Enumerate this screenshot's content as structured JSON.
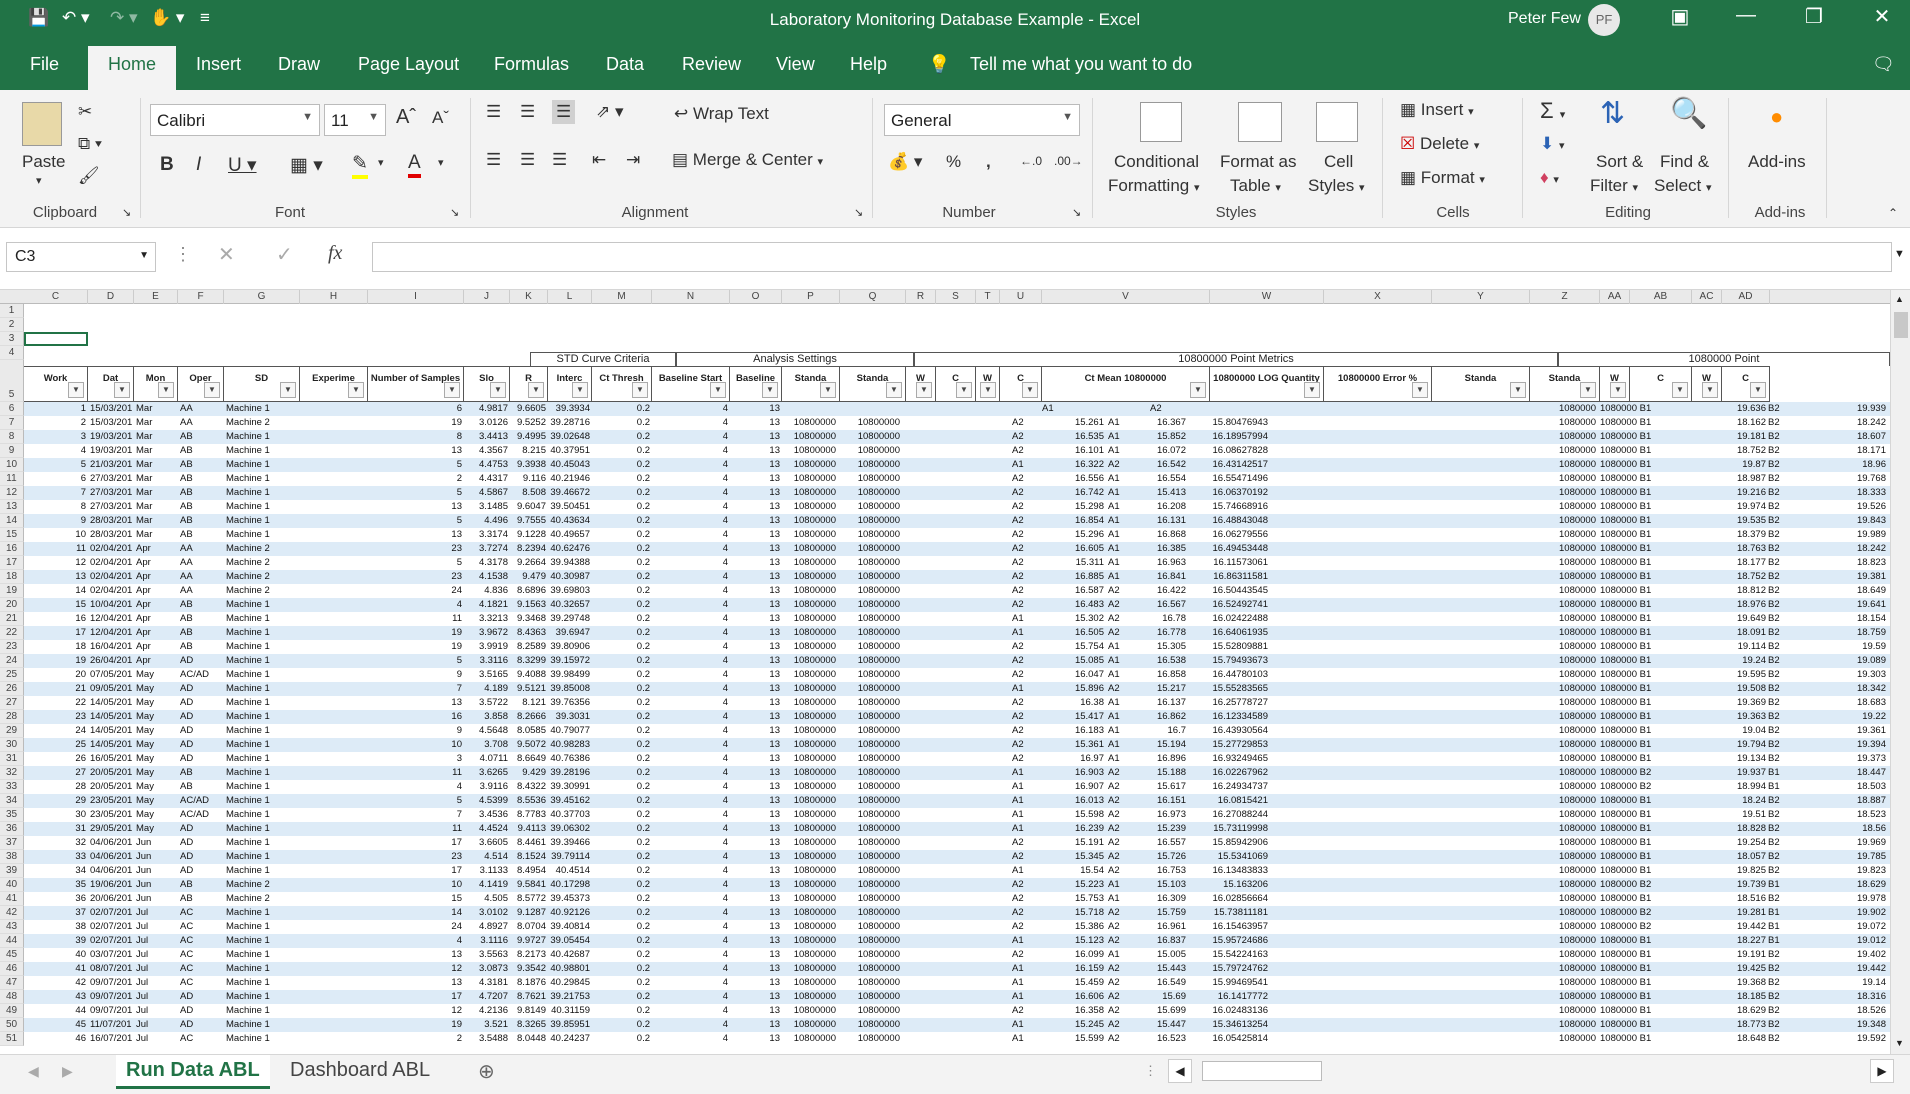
{
  "window": {
    "title": "Laboratory Monitoring Database Example  -  Excel",
    "user": "Peter Few",
    "initials": "PF"
  },
  "tabs": [
    "File",
    "Home",
    "Insert",
    "Draw",
    "Page Layout",
    "Formulas",
    "Data",
    "Review",
    "View",
    "Help"
  ],
  "tell_me": "Tell me what you want to do",
  "ribbon": {
    "clipboard": {
      "paste": "Paste",
      "label": "Clipboard"
    },
    "font": {
      "name": "Calibri",
      "size": "11",
      "label": "Font"
    },
    "alignment": {
      "wrap": "Wrap Text",
      "merge": "Merge & Center",
      "label": "Alignment"
    },
    "number": {
      "format": "General",
      "label": "Number",
      "pct": "%",
      "comma": ","
    },
    "styles": {
      "cond1": "Conditional",
      "cond2": "Formatting",
      "fmt1": "Format as",
      "fmt2": "Table",
      "cell1": "Cell",
      "cell2": "Styles",
      "label": "Styles"
    },
    "cells": {
      "insert": "Insert",
      "delete": "Delete",
      "format": "Format",
      "label": "Cells"
    },
    "editing": {
      "sort1": "Sort &",
      "sort2": "Filter",
      "find1": "Find &",
      "find2": "Select",
      "label": "Editing"
    },
    "addins": {
      "name": "Add-ins",
      "label": "Add-ins"
    }
  },
  "formula": {
    "namebox": "C3",
    "content": ""
  },
  "columns": [
    "C",
    "D",
    "E",
    "F",
    "G",
    "H",
    "I",
    "J",
    "K",
    "L",
    "M",
    "N",
    "O",
    "P",
    "Q",
    "R",
    "S",
    "T",
    "U",
    "V",
    "W",
    "X",
    "Y",
    "Z",
    "AA",
    "AB",
    "AC",
    "AD"
  ],
  "bands": {
    "std": "STD Curve Criteria",
    "analysis": "Analysis Settings",
    "metrics": "10800000 Point Metrics",
    "metrics2": "1080000 Point"
  },
  "headers": [
    "Work",
    "Dat",
    "Mon",
    "Oper",
    "SD",
    "Experime",
    "Number of Samples",
    "Slo",
    "R",
    "Interc",
    "Ct Thresh",
    "Baseline Start",
    "Baseline",
    "Standa",
    "Standa",
    "W",
    "C",
    "W",
    "C",
    "Ct Mean 10800000",
    "10800000 LOG Quantity",
    "10800000 Error %",
    "Standa",
    "Standa",
    "W",
    "C",
    "W",
    "C"
  ],
  "row6": {
    "num": "1",
    "date": "15/03/2019",
    "mon": "Mar",
    "op": "AA",
    "sd": "Machine 1",
    "ns": "6",
    "slope": "4.9817",
    "r": "9.6605",
    "int": "39.3934",
    "ct": "0.2",
    "bs": "4",
    "be": "13",
    "w1": "A1",
    "w2": "A2",
    "s3": "1080000",
    "s4": "1080000 B1",
    "cb": "19.636",
    "wb": "B2",
    "cd": "19.939"
  },
  "rows": [
    [
      "2",
      "15/03/2019",
      "Mar",
      "AA",
      "Machine 2",
      "19",
      "3.0126",
      "9.5252",
      "39.28716",
      "A2",
      "15.261",
      "A1",
      "16.367",
      "15.80476943",
      "1080000 B1",
      "18.162",
      "B2",
      "18.242"
    ],
    [
      "3",
      "19/03/2019",
      "Mar",
      "AB",
      "Machine 1",
      "8",
      "3.4413",
      "9.4995",
      "39.02648",
      "A2",
      "16.535",
      "A1",
      "15.852",
      "16.18957994",
      "1080000 B1",
      "19.181",
      "B2",
      "18.607"
    ],
    [
      "4",
      "19/03/2019",
      "Mar",
      "AB",
      "Machine 1",
      "13",
      "4.3567",
      "8.215",
      "40.37951",
      "A2",
      "16.101",
      "A1",
      "16.072",
      "16.08627828",
      "1080000 B1",
      "18.752",
      "B2",
      "18.171"
    ],
    [
      "5",
      "21/03/2019",
      "Mar",
      "AB",
      "Machine 1",
      "5",
      "4.4753",
      "9.3938",
      "40.45043",
      "A1",
      "16.322",
      "A2",
      "16.542",
      "16.43142517",
      "1080000 B1",
      "19.87",
      "B2",
      "18.96"
    ],
    [
      "6",
      "27/03/2019",
      "Mar",
      "AB",
      "Machine 1",
      "2",
      "4.4317",
      "9.116",
      "40.21946",
      "A2",
      "16.556",
      "A1",
      "16.554",
      "16.55471496",
      "1080000 B1",
      "18.987",
      "B2",
      "19.768"
    ],
    [
      "7",
      "27/03/2019",
      "Mar",
      "AB",
      "Machine 1",
      "5",
      "4.5867",
      "8.508",
      "39.46672",
      "A2",
      "16.742",
      "A1",
      "15.413",
      "16.06370192",
      "1080000 B1",
      "19.216",
      "B2",
      "18.333"
    ],
    [
      "8",
      "27/03/2019",
      "Mar",
      "AB",
      "Machine 1",
      "13",
      "3.1485",
      "9.6047",
      "39.50451",
      "A2",
      "15.298",
      "A1",
      "16.208",
      "15.74668916",
      "1080000 B1",
      "19.974",
      "B2",
      "19.526"
    ],
    [
      "9",
      "28/03/2019",
      "Mar",
      "AB",
      "Machine 1",
      "5",
      "4.496",
      "9.7555",
      "40.43634",
      "A2",
      "16.854",
      "A1",
      "16.131",
      "16.48843048",
      "1080000 B1",
      "19.535",
      "B2",
      "19.843"
    ],
    [
      "10",
      "28/03/2019",
      "Mar",
      "AB",
      "Machine 1",
      "13",
      "3.3174",
      "9.1228",
      "40.49657",
      "A2",
      "15.296",
      "A1",
      "16.868",
      "16.06279556",
      "1080000 B1",
      "18.379",
      "B2",
      "19.989"
    ],
    [
      "11",
      "02/04/2019",
      "Apr",
      "AA",
      "Machine 2",
      "23",
      "3.7274",
      "8.2394",
      "40.62476",
      "A2",
      "16.605",
      "A1",
      "16.385",
      "16.49453448",
      "1080000 B1",
      "18.763",
      "B2",
      "18.242"
    ],
    [
      "12",
      "02/04/2019",
      "Apr",
      "AA",
      "Machine 2",
      "5",
      "4.3178",
      "9.2664",
      "39.94388",
      "A2",
      "15.311",
      "A1",
      "16.963",
      "16.11573061",
      "1080000 B1",
      "18.177",
      "B2",
      "18.823"
    ],
    [
      "13",
      "02/04/2019",
      "Apr",
      "AA",
      "Machine 2",
      "23",
      "4.1538",
      "9.479",
      "40.30987",
      "A2",
      "16.885",
      "A1",
      "16.841",
      "16.86311581",
      "1080000 B1",
      "18.752",
      "B2",
      "19.381"
    ],
    [
      "14",
      "02/04/2019",
      "Apr",
      "AA",
      "Machine 2",
      "24",
      "4.836",
      "8.6896",
      "39.69803",
      "A2",
      "16.587",
      "A2",
      "16.422",
      "16.50443545",
      "1080000 B1",
      "18.812",
      "B2",
      "18.649"
    ],
    [
      "15",
      "10/04/2019",
      "Apr",
      "AB",
      "Machine 1",
      "4",
      "4.1821",
      "9.1563",
      "40.32657",
      "A2",
      "16.483",
      "A2",
      "16.567",
      "16.52492741",
      "1080000 B1",
      "18.976",
      "B2",
      "19.641"
    ],
    [
      "16",
      "12/04/2019",
      "Apr",
      "AB",
      "Machine 1",
      "11",
      "3.3213",
      "9.3468",
      "39.29748",
      "A1",
      "15.302",
      "A2",
      "16.78",
      "16.02422488",
      "1080000 B1",
      "19.649",
      "B2",
      "18.154"
    ],
    [
      "17",
      "12/04/2019",
      "Apr",
      "AB",
      "Machine 1",
      "19",
      "3.9672",
      "8.4363",
      "39.6947",
      "A1",
      "16.505",
      "A2",
      "16.778",
      "16.64061935",
      "1080000 B1",
      "18.091",
      "B2",
      "18.759"
    ],
    [
      "18",
      "16/04/2019",
      "Apr",
      "AB",
      "Machine 1",
      "19",
      "3.9919",
      "8.2589",
      "39.80906",
      "A2",
      "15.754",
      "A1",
      "15.305",
      "15.52809881",
      "1080000 B1",
      "19.114",
      "B2",
      "19.59"
    ],
    [
      "19",
      "26/04/2019",
      "Apr",
      "AD",
      "Machine 1",
      "5",
      "3.3116",
      "8.3299",
      "39.15972",
      "A2",
      "15.085",
      "A1",
      "16.538",
      "15.79493673",
      "1080000 B1",
      "19.24",
      "B2",
      "19.089"
    ],
    [
      "20",
      "07/05/2019",
      "May",
      "AC/AD",
      "Machine 1",
      "9",
      "3.5165",
      "9.4088",
      "39.98499",
      "A2",
      "16.047",
      "A1",
      "16.858",
      "16.44780103",
      "1080000 B1",
      "19.595",
      "B2",
      "19.303"
    ],
    [
      "21",
      "09/05/2019",
      "May",
      "AD",
      "Machine 1",
      "7",
      "4.189",
      "9.5121",
      "39.85008",
      "A1",
      "15.896",
      "A2",
      "15.217",
      "15.55283565",
      "1080000 B1",
      "19.508",
      "B2",
      "18.342"
    ],
    [
      "22",
      "14/05/2019",
      "May",
      "AD",
      "Machine 1",
      "13",
      "3.5722",
      "8.121",
      "39.76356",
      "A2",
      "16.38",
      "A1",
      "16.137",
      "16.25778727",
      "1080000 B1",
      "19.369",
      "B2",
      "18.683"
    ],
    [
      "23",
      "14/05/2019",
      "May",
      "AD",
      "Machine 1",
      "16",
      "3.858",
      "8.2666",
      "39.3031",
      "A2",
      "15.417",
      "A1",
      "16.862",
      "16.12334589",
      "1080000 B1",
      "19.363",
      "B2",
      "19.22"
    ],
    [
      "24",
      "14/05/2019",
      "May",
      "AD",
      "Machine 1",
      "9",
      "4.5648",
      "8.0585",
      "40.79077",
      "A2",
      "16.183",
      "A1",
      "16.7",
      "16.43930564",
      "1080000 B1",
      "19.04",
      "B2",
      "19.361"
    ],
    [
      "25",
      "14/05/2019",
      "May",
      "AD",
      "Machine 1",
      "10",
      "3.708",
      "9.5072",
      "40.98283",
      "A2",
      "15.361",
      "A1",
      "15.194",
      "15.27729853",
      "1080000 B1",
      "19.794",
      "B2",
      "19.394"
    ],
    [
      "26",
      "16/05/2019",
      "May",
      "AD",
      "Machine 1",
      "3",
      "4.0711",
      "8.6649",
      "40.76386",
      "A2",
      "16.97",
      "A1",
      "16.896",
      "16.93249465",
      "1080000 B1",
      "19.134",
      "B2",
      "19.373"
    ],
    [
      "27",
      "20/05/2019",
      "May",
      "AB",
      "Machine 1",
      "11",
      "3.6265",
      "9.429",
      "39.28196",
      "A1",
      "16.903",
      "A2",
      "15.188",
      "16.02267962",
      "1080000 B2",
      "19.937",
      "B1",
      "18.447"
    ],
    [
      "28",
      "20/05/2019",
      "May",
      "AB",
      "Machine 1",
      "4",
      "3.9116",
      "8.4322",
      "39.30991",
      "A1",
      "16.907",
      "A2",
      "15.617",
      "16.24934737",
      "1080000 B2",
      "18.994",
      "B1",
      "18.503"
    ],
    [
      "29",
      "23/05/2019",
      "May",
      "AC/AD",
      "Machine 1",
      "5",
      "4.5399",
      "8.5536",
      "39.45162",
      "A1",
      "16.013",
      "A2",
      "16.151",
      "16.0815421",
      "1080000 B1",
      "18.24",
      "B2",
      "18.887"
    ],
    [
      "30",
      "23/05/2019",
      "May",
      "AC/AD",
      "Machine 1",
      "7",
      "3.4536",
      "8.7783",
      "40.37703",
      "A1",
      "15.598",
      "A2",
      "16.973",
      "16.27088244",
      "1080000 B1",
      "19.51",
      "B2",
      "18.523"
    ],
    [
      "31",
      "29/05/2019",
      "May",
      "AD",
      "Machine 1",
      "11",
      "4.4524",
      "9.4113",
      "39.06302",
      "A1",
      "16.239",
      "A2",
      "15.239",
      "15.73119998",
      "1080000 B1",
      "18.828",
      "B2",
      "18.56"
    ],
    [
      "32",
      "04/06/2019",
      "Jun",
      "AD",
      "Machine 1",
      "17",
      "3.6605",
      "8.4461",
      "39.39466",
      "A2",
      "15.191",
      "A2",
      "16.557",
      "15.85942906",
      "1080000 B1",
      "19.254",
      "B2",
      "19.969"
    ],
    [
      "33",
      "04/06/2019",
      "Jun",
      "AD",
      "Machine 1",
      "23",
      "4.514",
      "8.1524",
      "39.79114",
      "A2",
      "15.345",
      "A2",
      "15.726",
      "15.5341069",
      "1080000 B1",
      "18.057",
      "B2",
      "19.785"
    ],
    [
      "34",
      "04/06/2019",
      "Jun",
      "AD",
      "Machine 1",
      "17",
      "3.1133",
      "8.4954",
      "40.4514",
      "A1",
      "15.54",
      "A2",
      "16.753",
      "16.13483833",
      "1080000 B1",
      "19.825",
      "B2",
      "19.823"
    ],
    [
      "35",
      "19/06/2019",
      "Jun",
      "AB",
      "Machine 2",
      "10",
      "4.1419",
      "9.5841",
      "40.17298",
      "A2",
      "15.223",
      "A1",
      "15.103",
      "15.163206",
      "1080000 B2",
      "19.739",
      "B1",
      "18.629"
    ],
    [
      "36",
      "20/06/2019",
      "Jun",
      "AB",
      "Machine 2",
      "15",
      "4.505",
      "8.5772",
      "39.45373",
      "A2",
      "15.753",
      "A1",
      "16.309",
      "16.02856664",
      "1080000 B1",
      "18.516",
      "B2",
      "19.978"
    ],
    [
      "37",
      "02/07/2019",
      "Jul",
      "AC",
      "Machine 1",
      "14",
      "3.0102",
      "9.1287",
      "40.92126",
      "A2",
      "15.718",
      "A2",
      "15.759",
      "15.73811181",
      "1080000 B2",
      "19.281",
      "B1",
      "19.902"
    ],
    [
      "38",
      "02/07/2019",
      "Jul",
      "AC",
      "Machine 1",
      "24",
      "4.8927",
      "8.0704",
      "39.40814",
      "A2",
      "15.386",
      "A2",
      "16.961",
      "16.15463957",
      "1080000 B2",
      "19.442",
      "B1",
      "19.072"
    ],
    [
      "39",
      "02/07/2019",
      "Jul",
      "AC",
      "Machine 1",
      "4",
      "3.1116",
      "9.9727",
      "39.05454",
      "A1",
      "15.123",
      "A2",
      "16.837",
      "15.95724686",
      "1080000 B1",
      "18.227",
      "B1",
      "19.012"
    ],
    [
      "40",
      "03/07/2019",
      "Jul",
      "AC",
      "Machine 1",
      "13",
      "3.5563",
      "8.2173",
      "40.42687",
      "A2",
      "16.099",
      "A1",
      "15.005",
      "15.54224163",
      "1080000 B1",
      "19.191",
      "B2",
      "19.402"
    ],
    [
      "41",
      "08/07/2019",
      "Jul",
      "AC",
      "Machine 1",
      "12",
      "3.0873",
      "9.3542",
      "40.98801",
      "A1",
      "16.159",
      "A2",
      "15.443",
      "15.79724762",
      "1080000 B1",
      "19.425",
      "B2",
      "19.442"
    ],
    [
      "42",
      "09/07/2019",
      "Jul",
      "AC",
      "Machine 1",
      "13",
      "4.3181",
      "8.1876",
      "40.29845",
      "A1",
      "15.459",
      "A2",
      "16.549",
      "15.99469541",
      "1080000 B1",
      "19.368",
      "B2",
      "19.14"
    ],
    [
      "43",
      "09/07/2019",
      "Jul",
      "AD",
      "Machine 1",
      "17",
      "4.7207",
      "8.7621",
      "39.21753",
      "A1",
      "16.606",
      "A2",
      "15.69",
      "16.1417772",
      "1080000 B1",
      "18.185",
      "B2",
      "18.316"
    ],
    [
      "44",
      "09/07/2019",
      "Jul",
      "AD",
      "Machine 1",
      "12",
      "4.2136",
      "9.8149",
      "40.31159",
      "A2",
      "16.358",
      "A2",
      "15.699",
      "16.02483136",
      "1080000 B1",
      "18.629",
      "B2",
      "18.526"
    ],
    [
      "45",
      "11/07/2019",
      "Jul",
      "AD",
      "Machine 1",
      "19",
      "3.521",
      "8.3265",
      "39.85951",
      "A1",
      "15.245",
      "A2",
      "15.447",
      "15.34613254",
      "1080000 B1",
      "18.773",
      "B2",
      "19.348"
    ],
    [
      "46",
      "16/07/2019",
      "Jul",
      "AC",
      "Machine 1",
      "2",
      "3.5488",
      "8.0448",
      "40.24237",
      "A1",
      "15.599",
      "A2",
      "16.523",
      "16.05425814",
      "1080000 B1",
      "18.648",
      "B2",
      "19.592"
    ]
  ],
  "rowconst": {
    "ct": "0.2",
    "bs": "4",
    "be": "13",
    "std": "10800000",
    "std2": "10800000",
    "y": "1080000"
  },
  "sheets": [
    "Run Data ABL",
    "Dashboard ABL"
  ],
  "accent": "#217346"
}
